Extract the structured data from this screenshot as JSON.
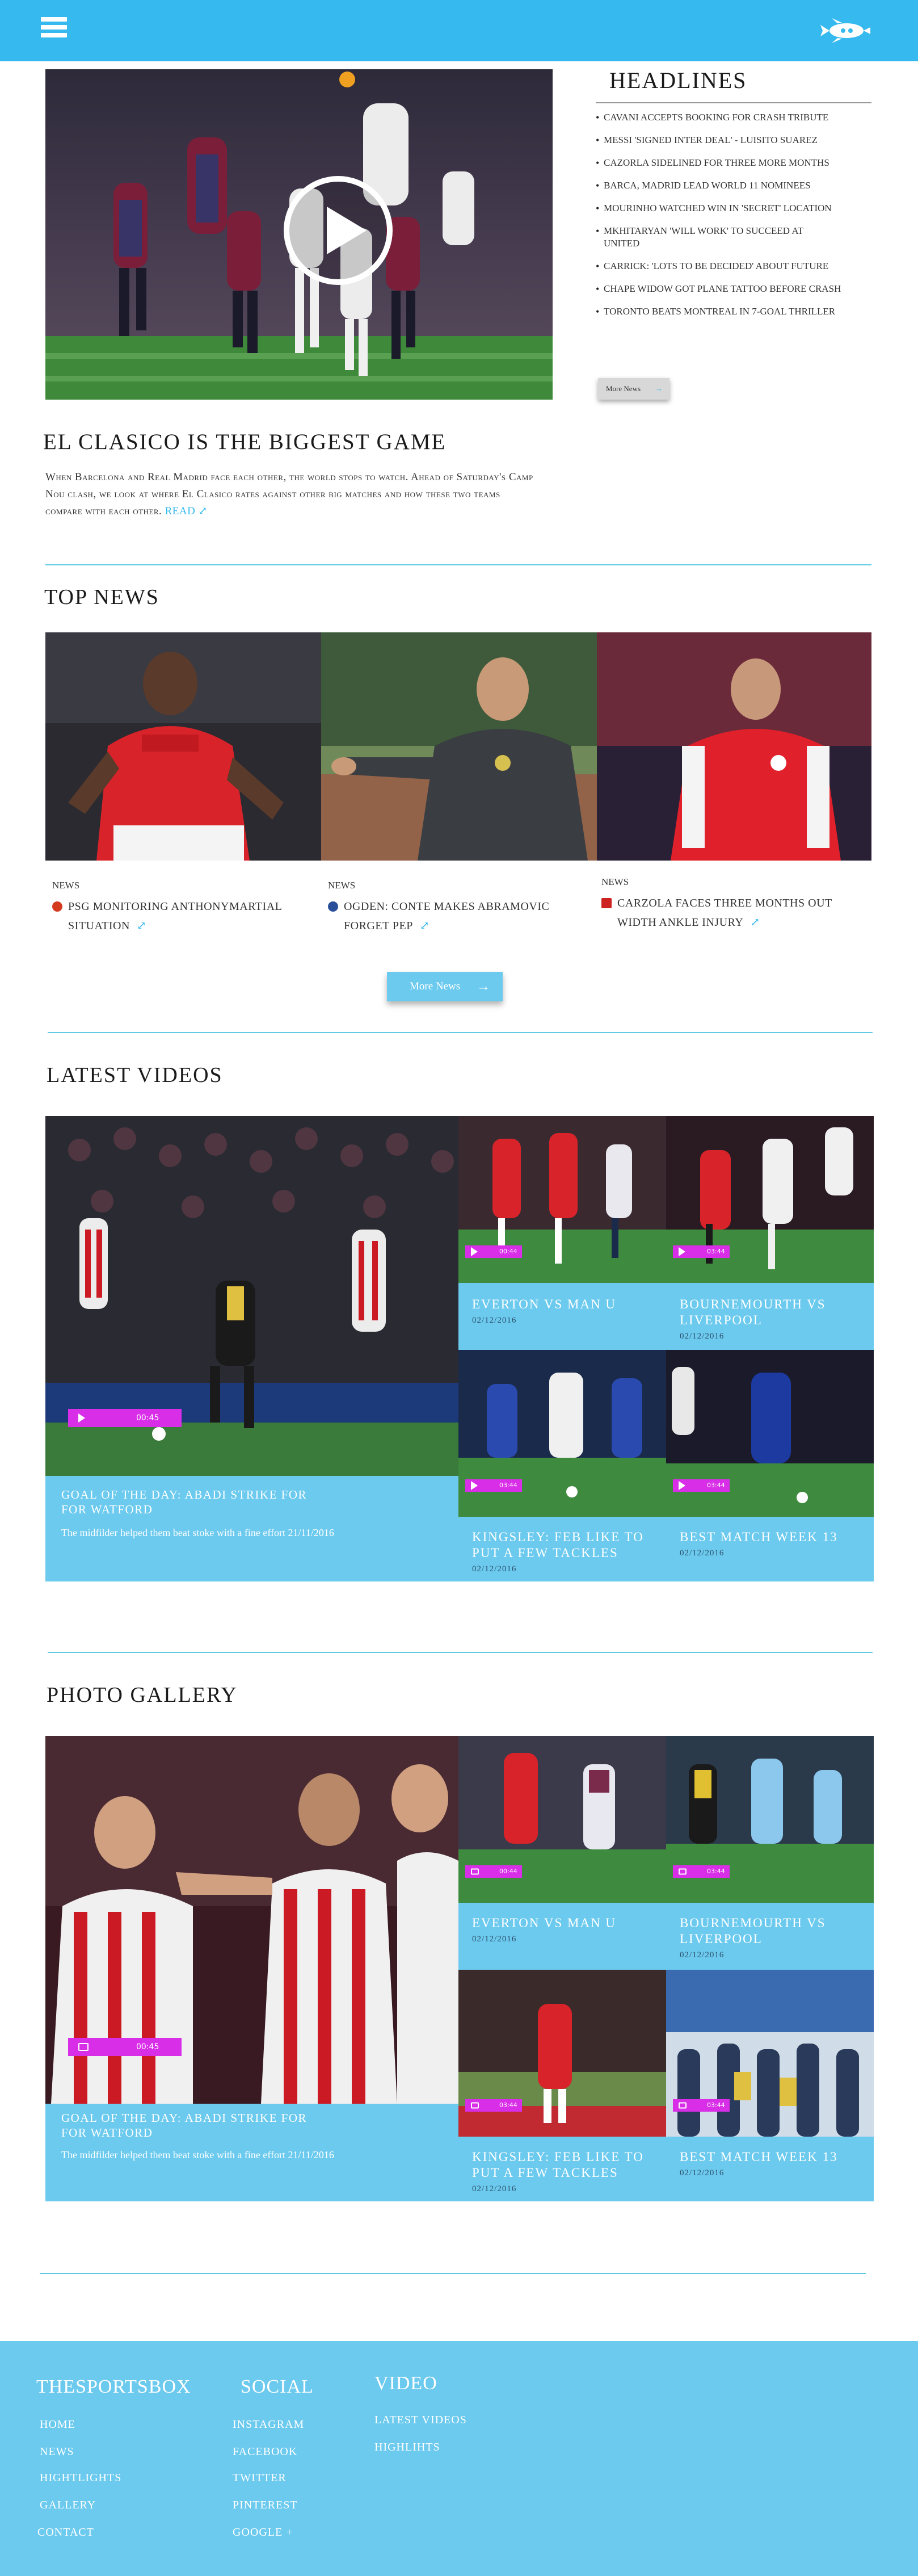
{
  "header": {
    "menu_icon": "hamburger-menu-icon",
    "logo_icon": "rocket-logo-icon",
    "brand_color": "#35b9ee"
  },
  "hero": {
    "play_icon": "play-icon",
    "title": "El Clasico is the biggest game",
    "description": "When Barcelona and Real Madrid face each other, the world stops to watch. Ahead of Saturday's Camp Nou clash, we look at where El Clasico rates against other big matches and how these two teams compare with each other.",
    "read_label": "Read"
  },
  "headlines": {
    "title": "Headlines",
    "items": [
      "Cavani accepts booking for crash tribute",
      "Messi 'signed Inter deal' - Luisito Suarez",
      "Cazorla sidelined for three more months",
      "Barca, Madrid lead World 11 nominees",
      "Mourinho watched win in 'secret' location",
      "Mkhitaryan 'will work' to succeed at United",
      "Carrick: 'Lots to be decided' about future",
      "Chape widow got plane tattoo before crash",
      "Toronto beats Montreal in 7-goal thriller"
    ],
    "more_label": "More News"
  },
  "top_news": {
    "title": "Top News",
    "items": [
      {
        "category": "News",
        "text": "PSG monitoring AnthonyMartial situation",
        "badge_color": "#d43a1e"
      },
      {
        "category": "News",
        "text": "Ogden: Conte makes Abramovic forget Pep",
        "badge_color": "#2a4f9a"
      },
      {
        "category": "News",
        "text": "Carzola faces three months out width ankle injury",
        "badge_color": "#cc2222"
      }
    ],
    "more_label": "More News"
  },
  "latest_videos": {
    "title": "Latest Videos",
    "featured": {
      "duration": "00:45",
      "title": "Goal of the day: Abadi strike for for Watford",
      "text": "The midfilder helped them beat stoke with a fine effort 21/11/2016"
    },
    "tiles": [
      {
        "title": "Everton vs Man U",
        "date": "02/12/2016",
        "duration": "00:44"
      },
      {
        "title": "Bournemourth vs Liverpool",
        "date": "02/12/2016",
        "duration": "03:44"
      },
      {
        "title": "Kingsley: Feb like to put a few tackles",
        "date": "02/12/2016",
        "duration": "03:44"
      },
      {
        "title": "Best match week 13",
        "date": "02/12/2016",
        "duration": "03:44"
      }
    ]
  },
  "photo_gallery": {
    "title": "Photo Gallery",
    "featured": {
      "count": "00:45",
      "title": "Goal of the day: Abadi strike for for Watford",
      "text": "The midfilder helped them beat stoke with a fine effort 21/11/2016"
    },
    "tiles": [
      {
        "title": "Everton vs Man U",
        "date": "02/12/2016",
        "count": "00:44"
      },
      {
        "title": "Bournemourth vs Liverpool",
        "date": "02/12/2016",
        "count": "03:44"
      },
      {
        "title": "Kingsley: Feb like to put a few tackles",
        "date": "02/12/2016",
        "count": "03:44"
      },
      {
        "title": "Best match week 13",
        "date": "02/12/2016",
        "count": "03:44"
      }
    ]
  },
  "footer": {
    "brand": "Thesportsbox",
    "brand_links": [
      "Home",
      "News",
      "Hightlights",
      "Gallery",
      "Contact"
    ],
    "social_title": "Social",
    "social_links": [
      "Instagram",
      "Facebook",
      "Twitter",
      "Pinterest",
      "Google +"
    ],
    "video_title": "Video",
    "video_links": [
      "Latest Videos",
      "Highlihts"
    ]
  }
}
